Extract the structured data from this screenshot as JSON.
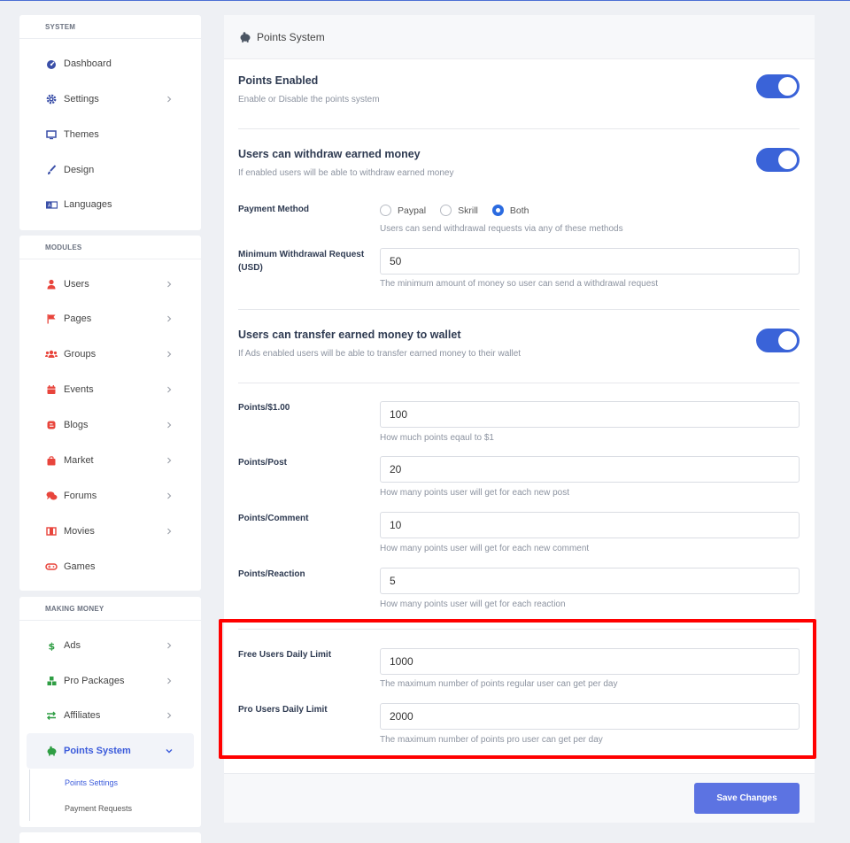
{
  "sidebar": {
    "system_head": "SYSTEM",
    "system_items": [
      {
        "label": "Dashboard",
        "icon": "dashboard-icon"
      },
      {
        "label": "Settings",
        "icon": "gear-icon"
      },
      {
        "label": "Themes",
        "icon": "monitor-icon"
      },
      {
        "label": "Design",
        "icon": "paint-brush-icon"
      },
      {
        "label": "Languages",
        "icon": "language-icon"
      }
    ],
    "modules_head": "MODULES",
    "module_items": [
      {
        "label": "Users",
        "icon": "user-icon"
      },
      {
        "label": "Pages",
        "icon": "flag-icon"
      },
      {
        "label": "Groups",
        "icon": "users-icon"
      },
      {
        "label": "Events",
        "icon": "calendar-icon"
      },
      {
        "label": "Blogs",
        "icon": "blog-icon"
      },
      {
        "label": "Market",
        "icon": "shopping-bag-icon"
      },
      {
        "label": "Forums",
        "icon": "comments-icon"
      },
      {
        "label": "Movies",
        "icon": "film-icon"
      },
      {
        "label": "Games",
        "icon": "gamepad-icon"
      }
    ],
    "money_head": "MAKING MONEY",
    "money_items": [
      {
        "label": "Ads",
        "icon": "dollar-icon"
      },
      {
        "label": "Pro Packages",
        "icon": "cubes-icon"
      },
      {
        "label": "Affiliates",
        "icon": "exchange-icon"
      },
      {
        "label": "Points System",
        "icon": "piggy-bank-icon"
      }
    ],
    "sub_items": [
      "Points Settings",
      "Payment Requests"
    ]
  },
  "main": {
    "header_title": "Points System",
    "points_enabled": {
      "title": "Points Enabled",
      "desc": "Enable or Disable the points system",
      "on": true
    },
    "withdraw": {
      "title": "Users can withdraw earned money",
      "desc": "If enabled users will be able to withdraw earned money",
      "on": true
    },
    "payment_method": {
      "label": "Payment Method",
      "options": [
        "Paypal",
        "Skrill",
        "Both"
      ],
      "selected": "Both",
      "help": "Users can send withdrawal requests via any of these methods"
    },
    "min_withdrawal": {
      "label": "Minimum Withdrawal Request (USD)",
      "value": "50",
      "help": "The minimum amount of money so user can send a withdrawal request"
    },
    "transfer": {
      "title": "Users can transfer earned money to wallet",
      "desc": "If Ads enabled users will be able to transfer earned money to their wallet",
      "on": true
    },
    "points_dollar": {
      "label": "Points/$1.00",
      "value": "100",
      "help": "How much points eqaul to $1"
    },
    "points_post": {
      "label": "Points/Post",
      "value": "20",
      "help": "How many points user will get for each new post"
    },
    "points_comment": {
      "label": "Points/Comment",
      "value": "10",
      "help": "How many points user will get for each new comment"
    },
    "points_reaction": {
      "label": "Points/Reaction",
      "value": "5",
      "help": "How many points user will get for each reaction"
    },
    "free_limit": {
      "label": "Free Users Daily Limit",
      "value": "1000",
      "help": "The maximum number of points regular user can get per day"
    },
    "pro_limit": {
      "label": "Pro Users Daily Limit",
      "value": "2000",
      "help": "The maximum number of points pro user can get per day"
    },
    "save_label": "Save Changes"
  },
  "colors": {
    "accent": "#3a63d8",
    "highlight": "#ff0000",
    "button": "#5c73e2"
  }
}
